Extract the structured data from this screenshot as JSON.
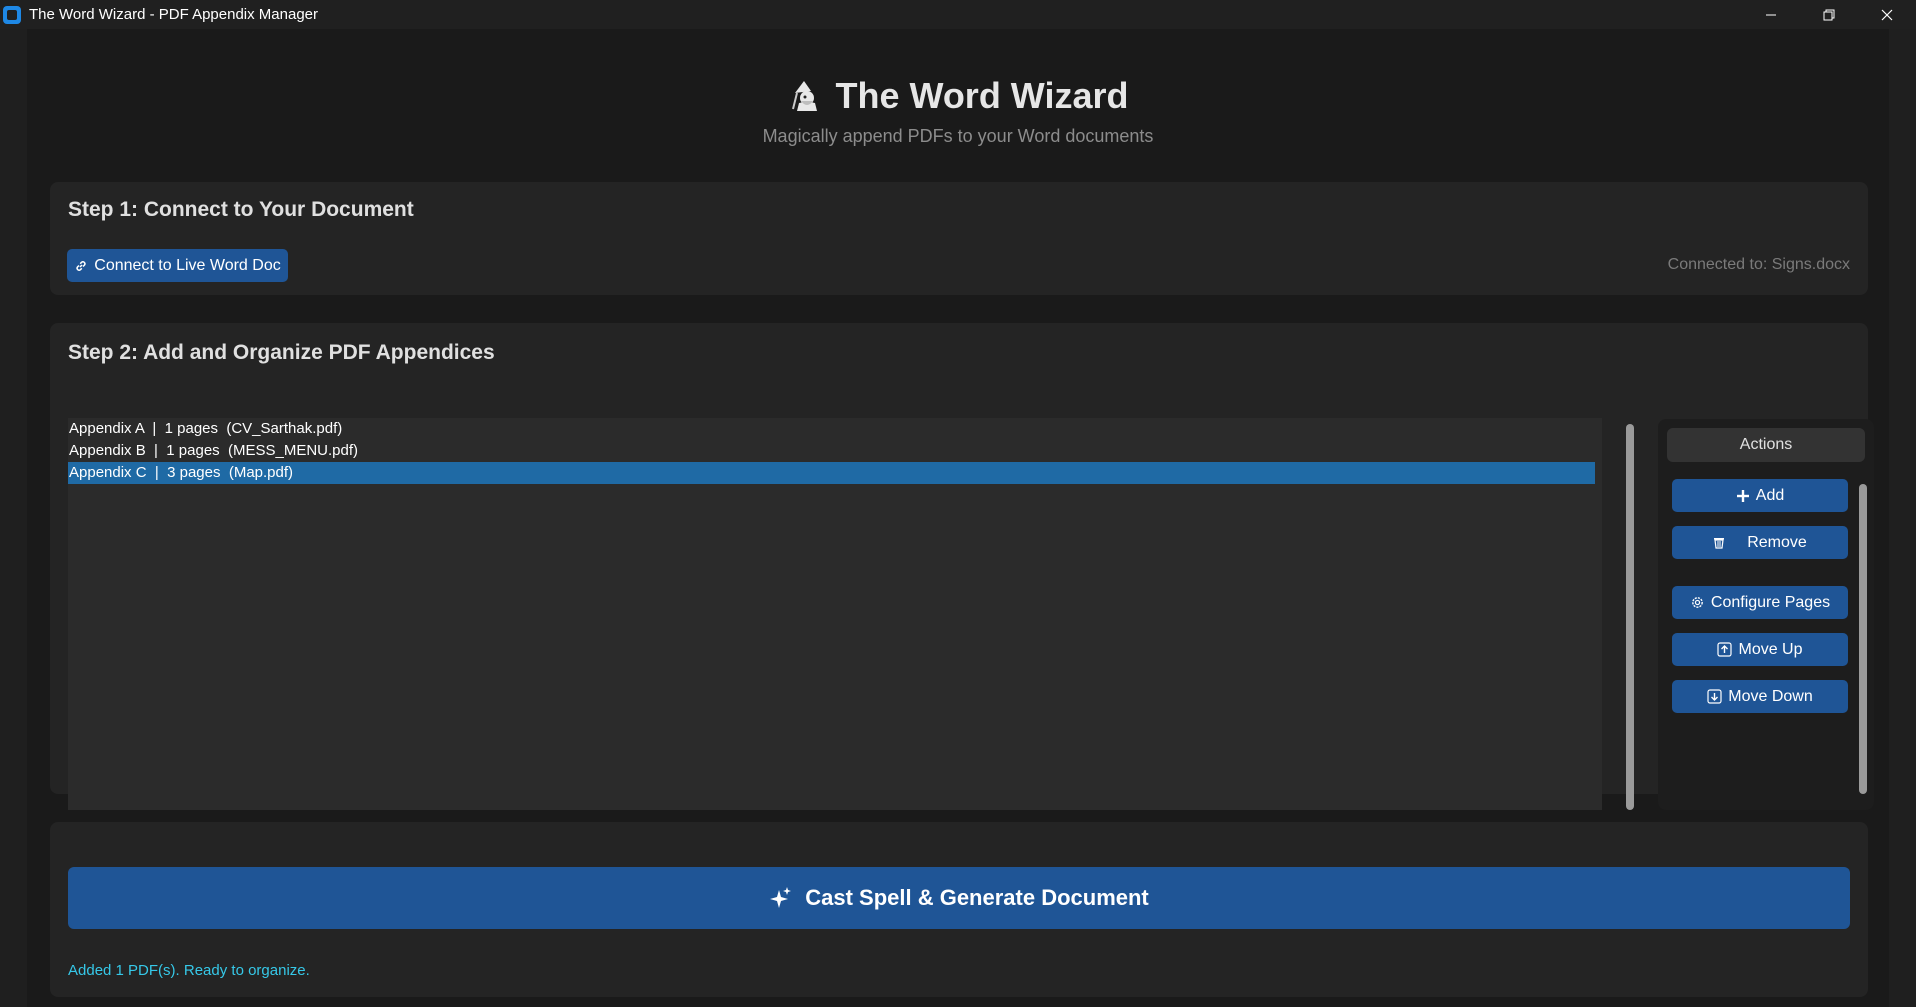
{
  "window": {
    "title": "The Word Wizard - PDF Appendix Manager",
    "controls": [
      "minimize-icon",
      "restore-icon",
      "close-icon"
    ]
  },
  "header": {
    "title": "The Word Wizard",
    "subtitle": "Magically append PDFs to your Word documents",
    "icon": "wizard-icon"
  },
  "step1": {
    "title": "Step 1: Connect to Your Document",
    "connect_label": "Connect to Live Word Doc",
    "connect_icon": "link-icon",
    "status": "Connected to: Signs.docx"
  },
  "step2": {
    "title": "Step 2: Add and Organize PDF Appendices",
    "items": [
      {
        "label": "Appendix A  |  1 pages  (CV_Sarthak.pdf)",
        "selected": false
      },
      {
        "label": "Appendix B  |  1 pages  (MESS_MENU.pdf)",
        "selected": false
      },
      {
        "label": "Appendix C  |  3 pages  (Map.pdf)",
        "selected": true
      }
    ],
    "actions": {
      "label": "Actions",
      "add": "Add",
      "remove": "Remove",
      "configure": "Configure Pages",
      "move_up": "Move Up",
      "move_down": "Move Down"
    }
  },
  "generate": {
    "label": "Cast Spell & Generate Document",
    "icon": "sparkles-icon"
  },
  "status": "Added 1 PDF(s). Ready to organize.",
  "colors": {
    "accent": "#1f5596",
    "selection": "#1f6aa5",
    "status_text": "#36c8e8",
    "background": "#1a1a1a",
    "card": "#242424"
  }
}
